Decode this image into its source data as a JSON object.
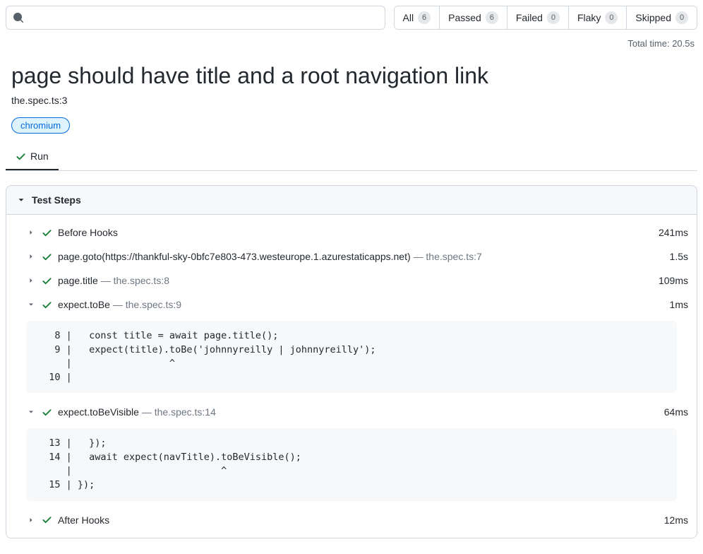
{
  "search": {
    "placeholder": ""
  },
  "filters": [
    {
      "label": "All",
      "count": 6
    },
    {
      "label": "Passed",
      "count": 6
    },
    {
      "label": "Failed",
      "count": 0
    },
    {
      "label": "Flaky",
      "count": 0
    },
    {
      "label": "Skipped",
      "count": 0
    }
  ],
  "total_time_label": "Total time: 20.5s",
  "test": {
    "title": "page should have title and a root navigation link",
    "location": "the.spec.ts:3",
    "browser": "chromium"
  },
  "tabs": [
    {
      "label": "Run",
      "active": true
    }
  ],
  "steps_panel_title": "Test Steps",
  "steps": {
    "s0": {
      "label": "Before Hooks",
      "duration": "241ms",
      "expanded": false,
      "location": null
    },
    "s1": {
      "label": "page.goto(https://thankful-sky-0bfc7e803-473.westeurope.1.azurestaticapps.net)",
      "location": "the.spec.ts:7",
      "duration": "1.5s",
      "expanded": false
    },
    "s2": {
      "label": "page.title",
      "location": "the.spec.ts:8",
      "duration": "109ms",
      "expanded": false
    },
    "s3": {
      "label": "expect.toBe",
      "location": "the.spec.ts:9",
      "duration": "1ms",
      "expanded": true,
      "code": "   8 |   const title = await page.title();\n   9 |   expect(title).toBe('johnnyreilly | johnnyreilly');\n     |                 ^\n  10 | "
    },
    "s4": {
      "label": "expect.toBeVisible",
      "location": "the.spec.ts:14",
      "duration": "64ms",
      "expanded": true,
      "code": "  13 |   });\n  14 |   await expect(navTitle).toBeVisible();\n     |                          ^\n  15 | });"
    },
    "s5": {
      "label": "After Hooks",
      "duration": "12ms",
      "expanded": false,
      "location": null
    }
  }
}
